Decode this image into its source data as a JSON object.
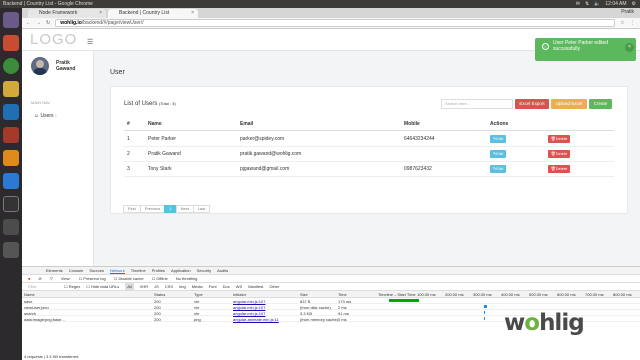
{
  "os": {
    "window_title": "Backend | Country List - Google Chrome",
    "time": "12:04 AM"
  },
  "browser": {
    "tabs": [
      {
        "label": "Node Framework"
      },
      {
        "label": "Backend | Country List"
      }
    ],
    "user": "Pratik",
    "url_host": "wohlig.io",
    "url_path": "/backend/#/page/viewUser//"
  },
  "app": {
    "logo": "LOGO",
    "sidebar": {
      "user_name": "Pratik Gawand",
      "main_nav": "MAIN NAV",
      "users": "Users"
    },
    "page_title": "User",
    "toast": "User Peter Parker edited successfully",
    "card": {
      "title": "List of Users",
      "total": "(Total : 3)",
      "search_placeholder": "Search here...",
      "buttons": {
        "excel_export": "Excel Export",
        "upload_excel": "Upload Excel",
        "create": "Create"
      },
      "columns": [
        "#",
        "Name",
        "Email",
        "Mobile",
        "Actions"
      ],
      "rows": [
        {
          "n": "1",
          "name": "Peter Parker",
          "email": "parker@spidey.com",
          "mobile": "64643234244"
        },
        {
          "n": "2",
          "name": "Pratik Gawand",
          "email": "pratik.gawand@wohlig.com",
          "mobile": ""
        },
        {
          "n": "3",
          "name": "Tony Stark",
          "email": "pjgawand@gmail.com",
          "mobile": "0987623432"
        }
      ],
      "edit": "Edit",
      "delete": "Delete",
      "pager": [
        "First",
        "Previous",
        "1",
        "Next",
        "Last"
      ]
    }
  },
  "devtools": {
    "tabs": [
      "Elements",
      "Console",
      "Sources",
      "Network",
      "Timeline",
      "Profiles",
      "Application",
      "Security",
      "Audits"
    ],
    "toolbar": [
      "View:",
      "Preserve log",
      "Disable cache",
      "Offline",
      "No throttling"
    ],
    "filters": [
      "Filter",
      "Regex",
      "Hide data URLs",
      "All",
      "XHR",
      "JS",
      "CSS",
      "Img",
      "Media",
      "Font",
      "Doc",
      "WS",
      "Manifest",
      "Other"
    ],
    "columns": [
      "Name",
      "Status",
      "Type",
      "Initiator",
      "Size",
      "Time",
      "Timeline – Start Time"
    ],
    "ticks": [
      "100.00 ms",
      "200.00 ms",
      "300.00 ms",
      "400.00 ms",
      "500.00 ms",
      "600.00 ms",
      "700.00 ms",
      "800.00 ms"
    ],
    "requests": [
      {
        "name": "save",
        "status": "200",
        "type": "xhr",
        "initiator": "angular.min.js:107",
        "size": "837 B",
        "time": "173 ms",
        "start": 0.02,
        "dur": 0.12
      },
      {
        "name": "viewUser.json",
        "status": "200",
        "type": "xhr",
        "initiator": "angular.min.js:107",
        "size": "(from disk cache)",
        "time": "2 ms",
        "start": 0.4,
        "dur": 0.01
      },
      {
        "name": "search",
        "status": "200",
        "type": "xhr",
        "initiator": "angular.min.js:107",
        "size": "3.3 KB",
        "time": "91 ms",
        "start": 0.4,
        "dur": 0.005
      },
      {
        "name": "data:image/png;base...",
        "status": "200",
        "type": "png",
        "initiator": "angular-animate.min.js:11",
        "size": "(from memory cache)",
        "time": "0 ms",
        "start": 0.4,
        "dur": 0
      }
    ],
    "status": "4 requests | 3.3 KB transferred"
  },
  "watermark": {
    "pre": "w",
    "o": "o",
    "post": "hlig"
  }
}
